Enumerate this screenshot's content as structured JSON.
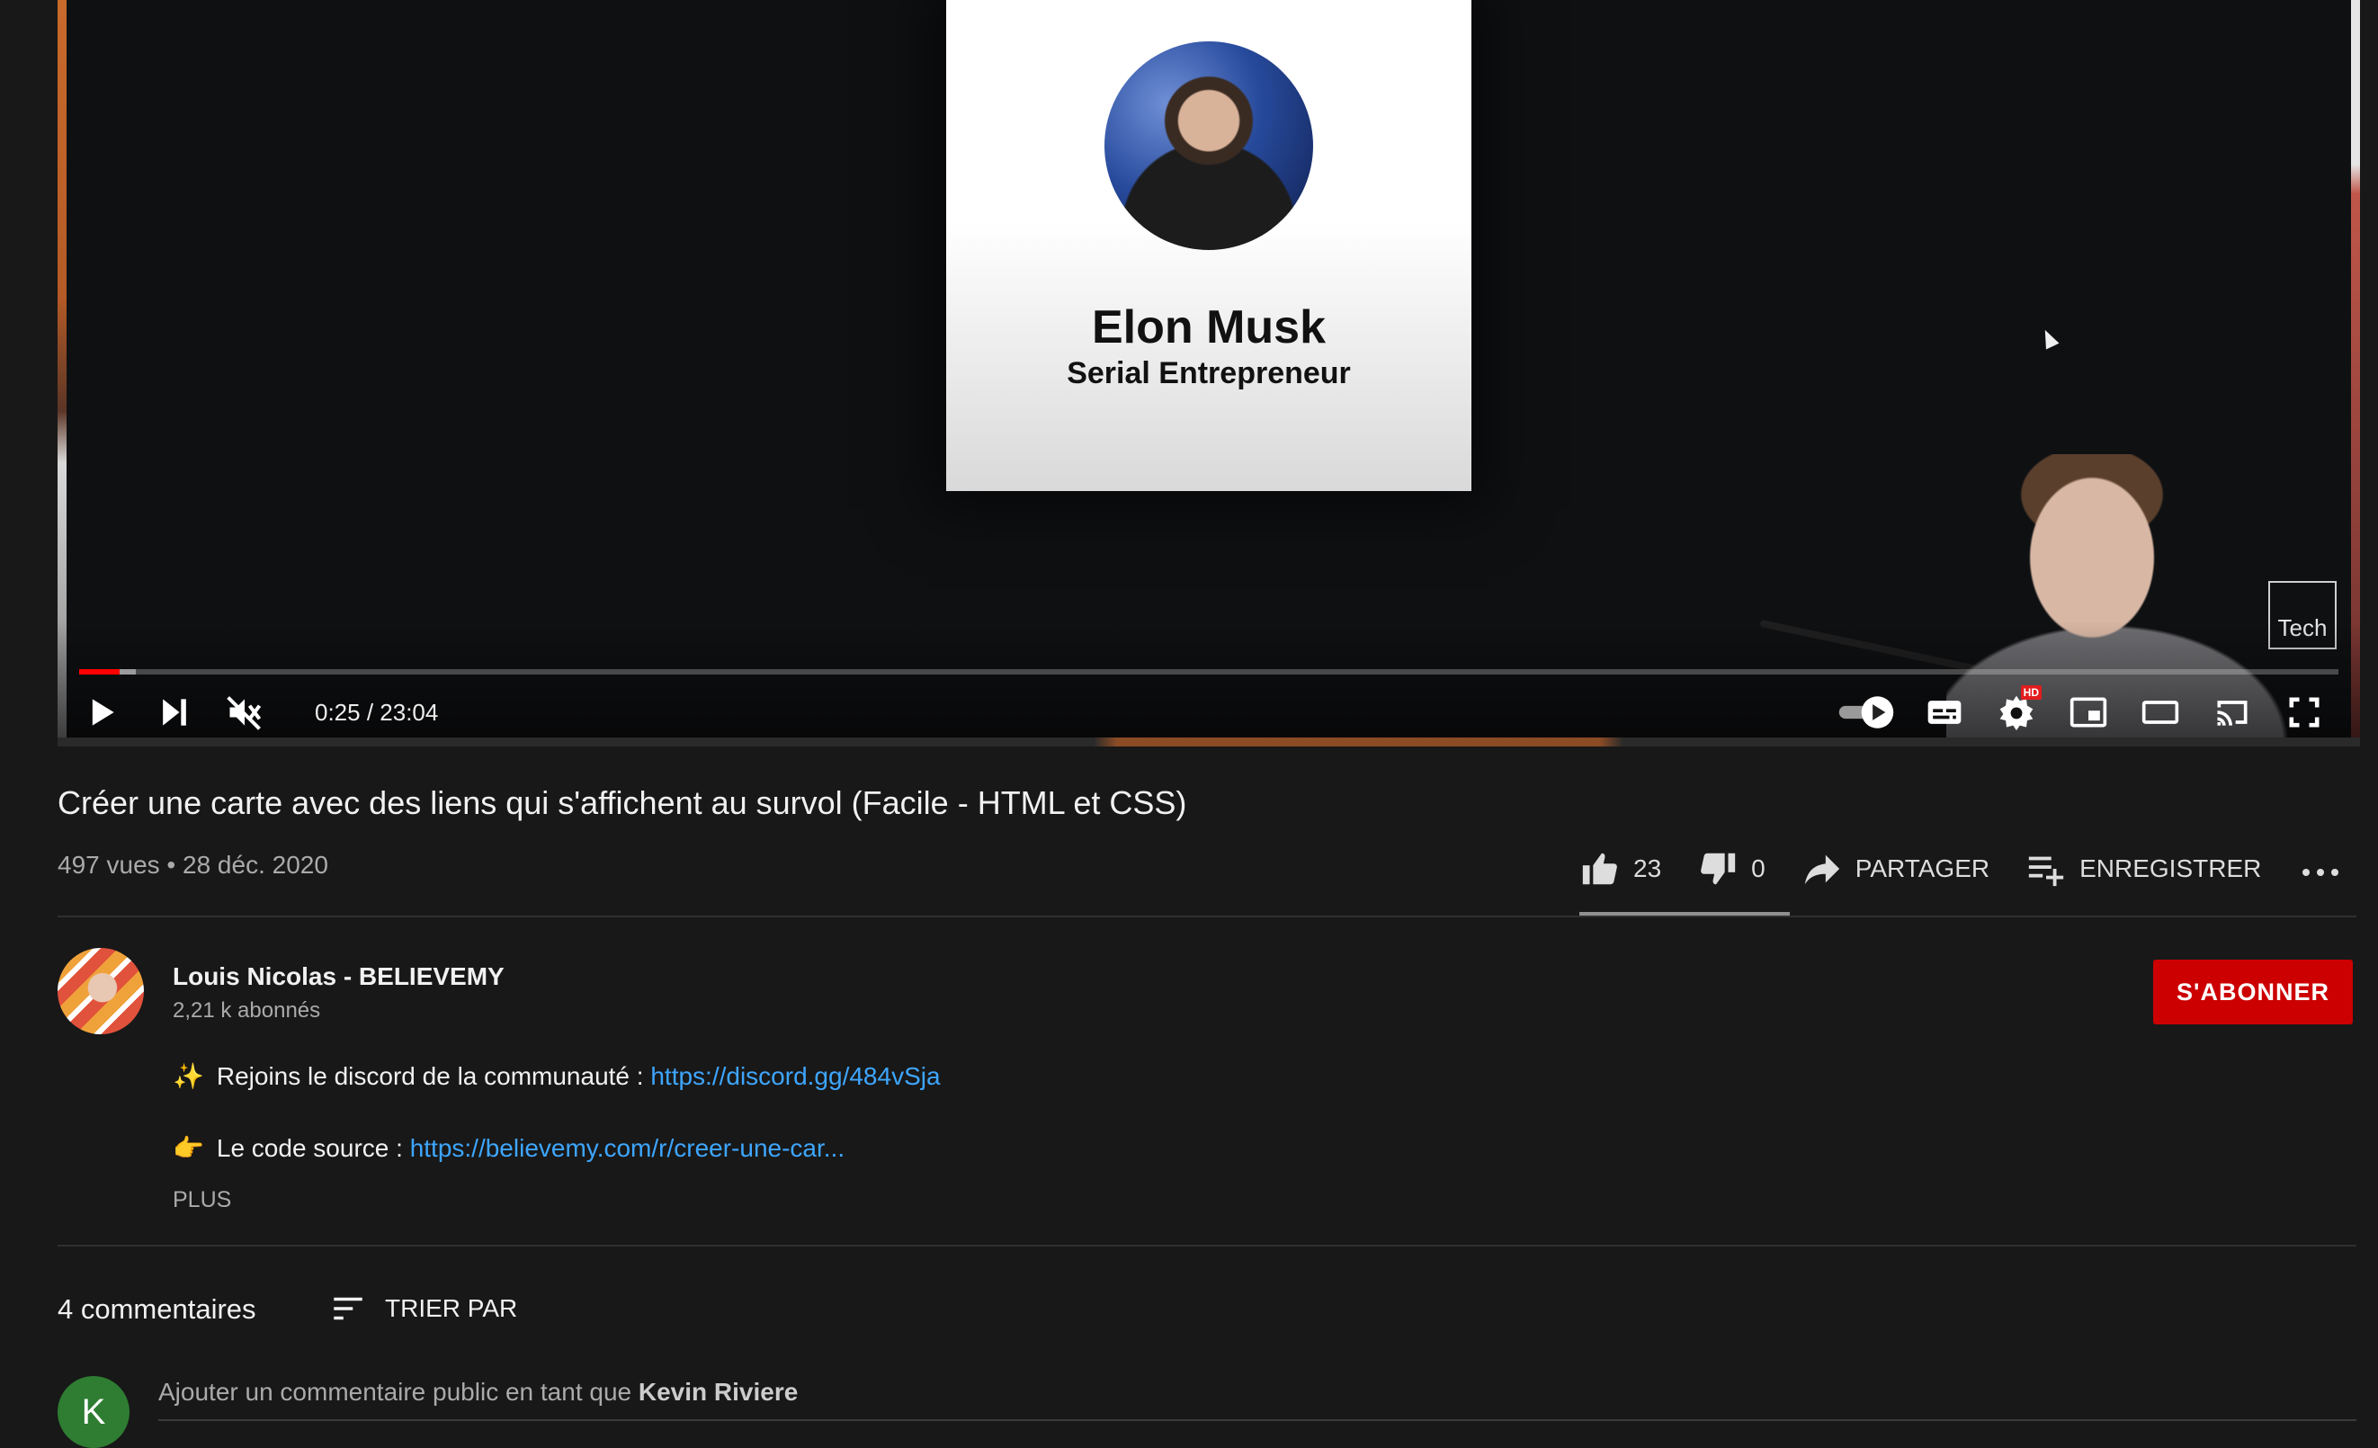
{
  "player": {
    "slide": {
      "name": "Elon Musk",
      "role": "Serial Entrepreneur"
    },
    "watermark": "Tech",
    "progress": {
      "played_fraction": 0.018,
      "loaded_fraction": 0.025
    },
    "time": "0:25 / 23:04",
    "icons": [
      "play-icon",
      "next-icon",
      "muted-volume-icon",
      "autoplay-toggle-icon",
      "subtitles-icon",
      "settings-icon",
      "miniplayer-icon",
      "theater-mode-icon",
      "cast-icon",
      "fullscreen-icon"
    ],
    "hd_badge": "HD"
  },
  "video": {
    "title": "Créer une carte avec des liens qui s'affichent au survol (Facile - HTML et CSS)",
    "meta": "497 vues • 28 déc. 2020"
  },
  "actions": {
    "likes": "23",
    "dislikes": "0",
    "share_label": "PARTAGER",
    "save_label": "ENREGISTRER"
  },
  "channel": {
    "name": "Louis Nicolas - BELIEVEMY",
    "subscribers": "2,21 k abonnés",
    "subscribe_label": "S'ABONNER"
  },
  "description": {
    "line1_emoji": "✨",
    "line1_text": "Rejoins le discord de la communauté : ",
    "line1_link": "https://discord.gg/484vSja",
    "line2_emoji": "👉",
    "line2_text": "Le code source : ",
    "line2_link": "https://believemy.com/r/creer-une-car...",
    "more_label": "PLUS"
  },
  "comments": {
    "count_label": "4 commentaires",
    "sort_label": "TRIER PAR",
    "user_initial": "K",
    "input_prefix": "Ajouter un commentaire public en tant que ",
    "input_user": "Kevin Riviere"
  },
  "colors": {
    "background": "#181818",
    "accent_red": "#cc0000",
    "progress_red": "#ff0000",
    "link_blue": "#3ea6ff",
    "user_avatar_green": "#2e7d32"
  }
}
